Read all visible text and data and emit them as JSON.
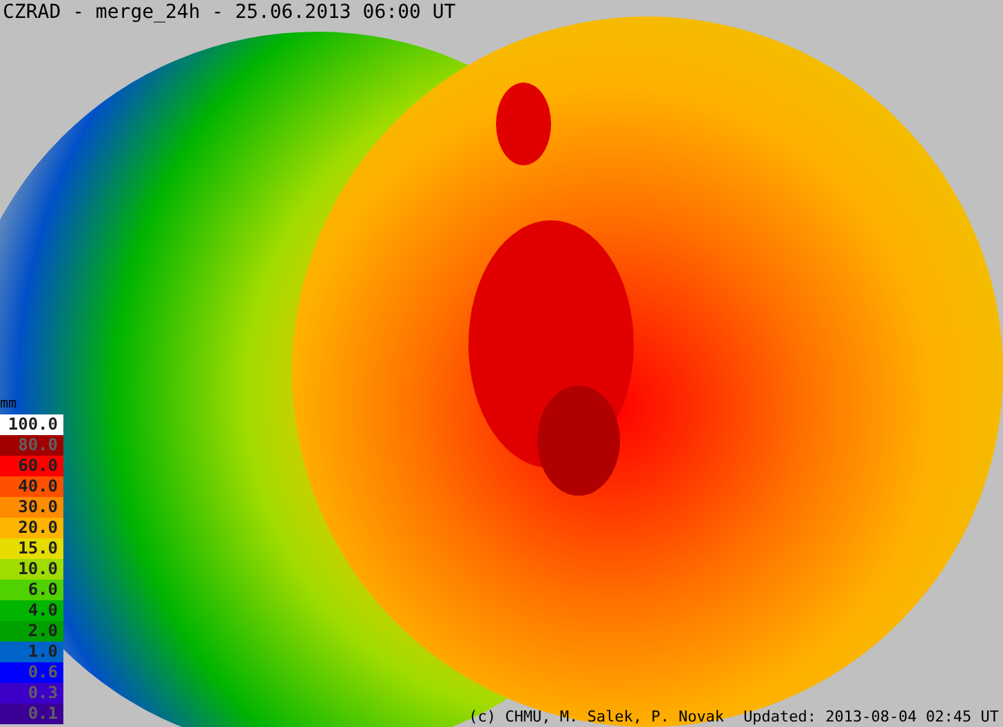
{
  "title": "CZRAD - merge_24h - 25.06.2013 06:00 UT",
  "legend": {
    "unit": "mm",
    "items": [
      {
        "label": "100.0",
        "color": "#ffffff"
      },
      {
        "label": "80.0",
        "color": "#a00000"
      },
      {
        "label": "60.0",
        "color": "#ff0000"
      },
      {
        "label": "40.0",
        "color": "#ff5000"
      },
      {
        "label": "30.0",
        "color": "#ff8c00"
      },
      {
        "label": "20.0",
        "color": "#ffb400"
      },
      {
        "label": "15.0",
        "color": "#e6dc00"
      },
      {
        "label": "10.0",
        "color": "#a0dc00"
      },
      {
        "label": "6.0",
        "color": "#50d200"
      },
      {
        "label": "4.0",
        "color": "#00b400"
      },
      {
        "label": "2.0",
        "color": "#00a000"
      },
      {
        "label": "1.0",
        "color": "#0064c8"
      },
      {
        "label": "0.6",
        "color": "#0000ff"
      },
      {
        "label": "0.3",
        "color": "#3c00c8"
      },
      {
        "label": "0.1",
        "color": "#3c0096"
      }
    ]
  },
  "credit": "(c) CHMU, M. Salek, P. Novak",
  "updated": "Updated: 2013-08-04 02:45 UT"
}
